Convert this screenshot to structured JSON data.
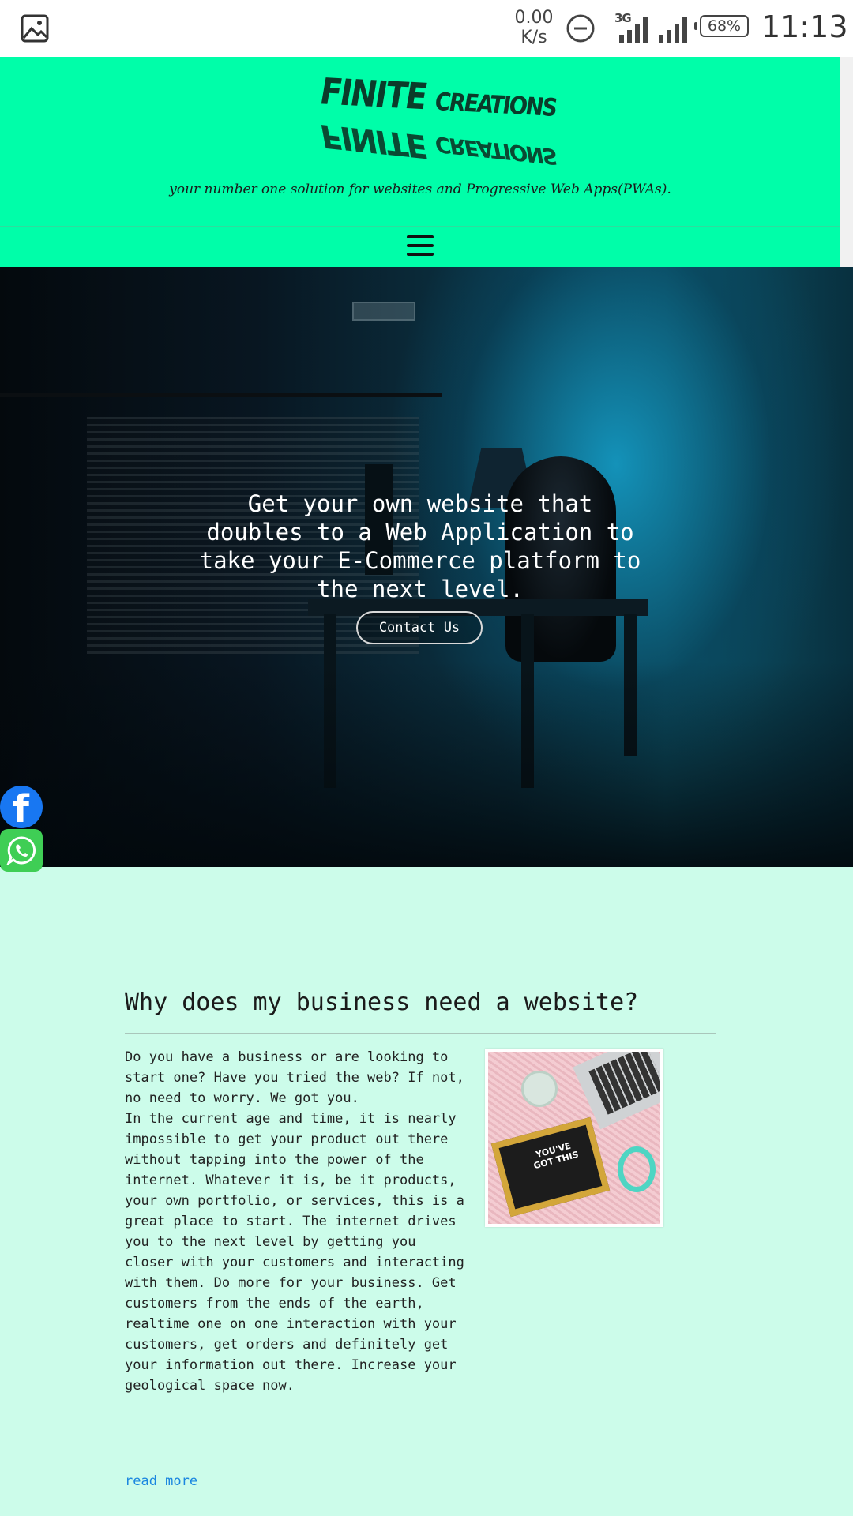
{
  "status_bar": {
    "net_speed": "0.00",
    "net_unit": "K/s",
    "network_type": "3G",
    "battery": "68%",
    "time": "11:13",
    "icons": [
      "gallery-icon",
      "dnd-icon",
      "signal-icon",
      "signal-icon",
      "battery-icon"
    ]
  },
  "header": {
    "logo_line1": "FINITE",
    "logo_line2": "CREATIONS",
    "tagline": "your number one solution for websites and Progressive Web Apps(PWAs).",
    "menu_icon": "hamburger-menu-icon",
    "colors": {
      "background": "#00fea9"
    }
  },
  "hero": {
    "headline": "Get your own website that doubles to a Web Application to take your E-Commerce platform to the next level.",
    "cta_label": "Contact Us"
  },
  "social": {
    "facebook_icon": "facebook-icon",
    "whatsapp_icon": "whatsapp-icon",
    "facebook_color": "#1877f2",
    "whatsapp_color": "#3fce55"
  },
  "article": {
    "title": "Why does my business need a website?",
    "body": "Do you have a business or are looking to start one? Have you tried the web? If not, no need to worry. We got you.\nIn the current age and time, it is nearly impossible to get your product out there without tapping into the power of the internet. Whatever it is, be it products, your own portfolio, or services, this is a great place to start. The internet drives you to the next level by getting you closer with your customers and interacting with them. Do more for your business. Get customers from the ends of the earth, realtime one on one interaction with your customers, get orders and definitely get your information out there. Increase your geological space now.",
    "photo_text": "YOU'VE GOT THIS",
    "read_more": "read more",
    "colors": {
      "background": "#ccfcea",
      "link": "#1a86e0"
    }
  }
}
